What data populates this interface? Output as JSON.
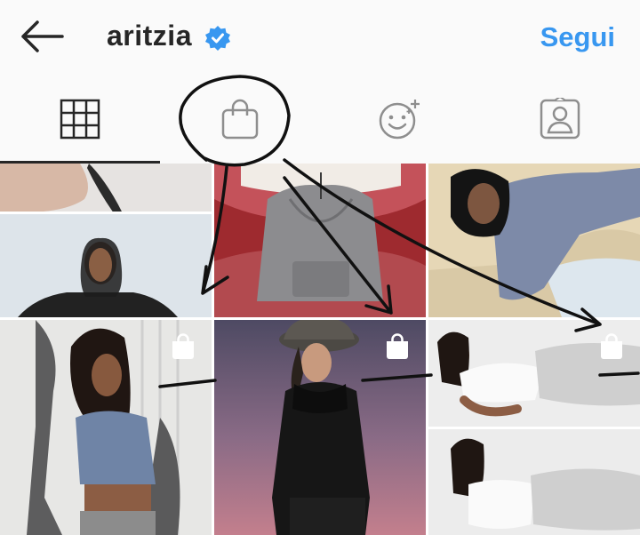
{
  "header": {
    "back_icon": "arrow-left-icon",
    "username": "aritzia",
    "verified_icon": "verified-badge-icon",
    "follow_label": "Segui",
    "accent_color": "#3897f0"
  },
  "tabs": [
    {
      "name": "posts-grid",
      "icon": "grid-icon",
      "selected": true
    },
    {
      "name": "shop",
      "icon": "shopping-bag-icon",
      "selected": false
    },
    {
      "name": "reels-effects",
      "icon": "sparkle-face-icon",
      "selected": false
    },
    {
      "name": "tagged",
      "icon": "person-tag-icon",
      "selected": false
    }
  ],
  "grid": {
    "tiles": [
      {
        "id": "tile-1",
        "shoppable": false
      },
      {
        "id": "tile-2",
        "shoppable": false
      },
      {
        "id": "tile-3",
        "shoppable": false
      },
      {
        "id": "tile-4",
        "shoppable": true
      },
      {
        "id": "tile-5",
        "shoppable": true
      },
      {
        "id": "tile-6",
        "shoppable": true
      }
    ]
  }
}
